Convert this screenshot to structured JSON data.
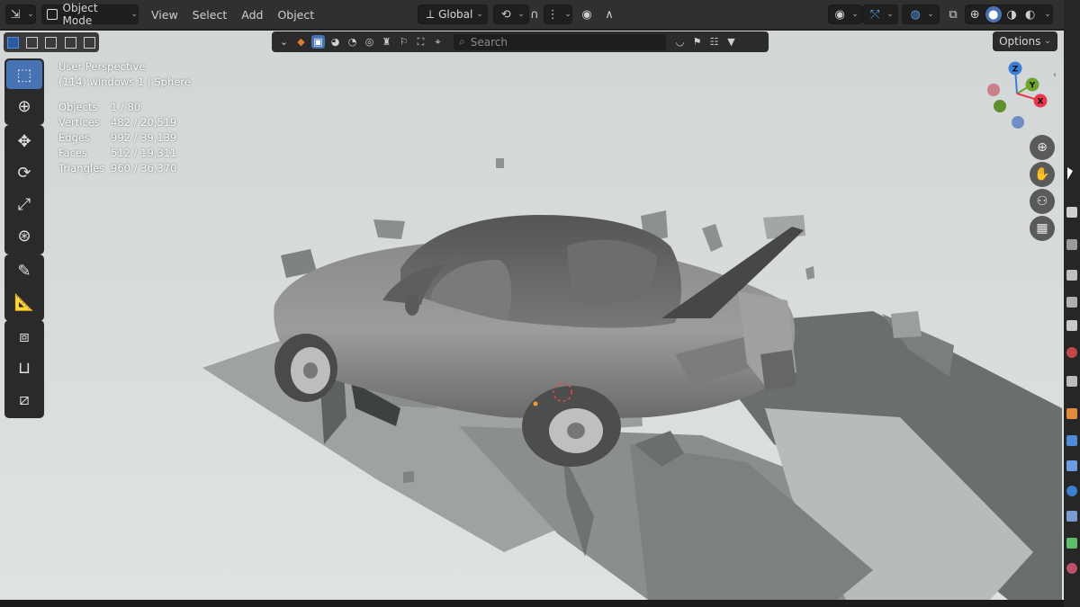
{
  "header": {
    "mode_label": "Object Mode",
    "menus": [
      "View",
      "Select",
      "Add",
      "Object"
    ],
    "transform_orientation": "Global"
  },
  "viewport_header": {
    "search_placeholder": "Search",
    "options_label": "Options"
  },
  "overlay": {
    "view_name": "User Perspective",
    "context": "(114) windows 1 | Sphere",
    "stats": [
      {
        "label": "Objects",
        "value": "1 / 80"
      },
      {
        "label": "Vertices",
        "value": "482 / 20,519"
      },
      {
        "label": "Edges",
        "value": "992 / 39,139"
      },
      {
        "label": "Faces",
        "value": "512 / 19,311"
      },
      {
        "label": "Triangles",
        "value": "960 / 36,370"
      }
    ]
  },
  "gizmo": {
    "axes": [
      "Z",
      "Y",
      "X"
    ],
    "colors": {
      "x": "#e8374c",
      "y": "#6ca52c",
      "z": "#3b7fd6"
    }
  },
  "tools": [
    "select-box",
    "cursor",
    "move",
    "rotate",
    "scale",
    "transform",
    "annotate",
    "measure",
    "add-cube",
    "uv",
    "shear"
  ],
  "colors": {
    "accent": "#4772b3",
    "viewport_bg": "#d7dbdb",
    "header_bg": "#303030"
  }
}
